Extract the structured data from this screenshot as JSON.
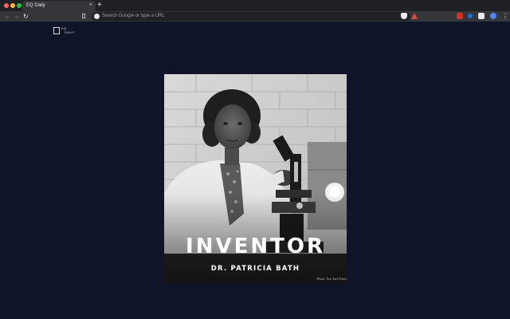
{
  "browser": {
    "tab_title": "EQ Daily",
    "tab_close": "×",
    "new_tab": "+",
    "omnibox_placeholder": "Search Google or type a URL",
    "nav": {
      "back": "←",
      "forward": "→",
      "reload": "↻"
    },
    "menu": "⋮",
    "icons": [
      "back-icon",
      "forward-icon",
      "reload-icon",
      "bookmark-icon",
      "google-icon",
      "shield-extension-icon",
      "triangle-extension-icon",
      "red-extension-icon",
      "blue-extension-icon",
      "white-extension-icon",
      "profile-avatar-icon",
      "menu-icon"
    ]
  },
  "page": {
    "logo": {
      "eq": "EQ",
      "daily": "DAILY"
    },
    "card": {
      "headline": "INVENTOR",
      "subhead": "DR. PATRICIA BATH",
      "credit": "Photo: New York Times"
    },
    "colors": {
      "background": "#0f1429",
      "text": "#ffffff"
    }
  }
}
